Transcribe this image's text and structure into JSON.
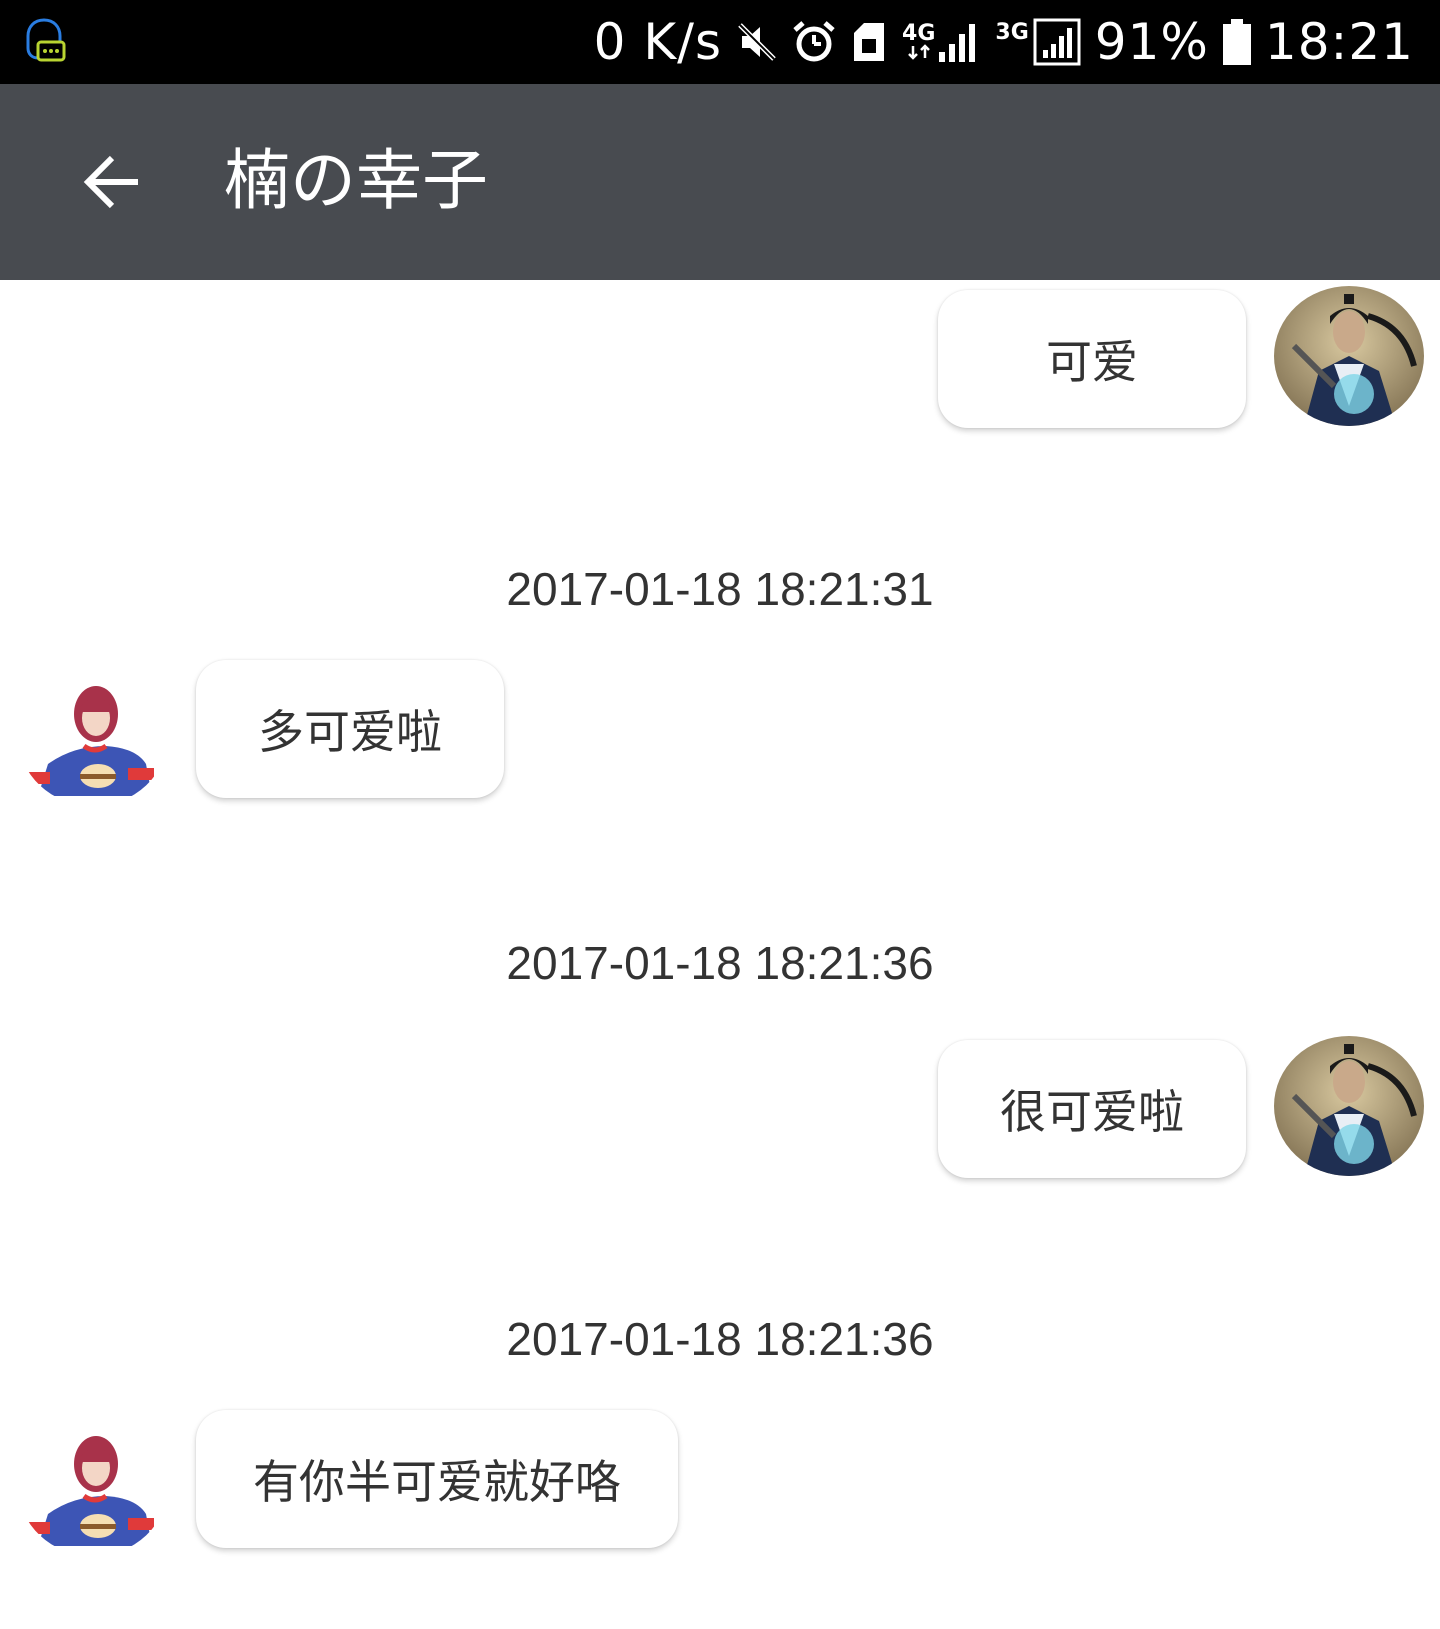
{
  "status_bar": {
    "net_speed": "0 K/s",
    "network_4g": "4G",
    "network_3g": "3G",
    "battery": "91%",
    "time": "18:21"
  },
  "header": {
    "title": "楠の幸子"
  },
  "messages": [
    {
      "sender": "me",
      "text": "可爱"
    },
    {
      "timestamp": "2017-01-18 18:21:31"
    },
    {
      "sender": "other",
      "text": "多可爱啦"
    },
    {
      "timestamp": "2017-01-18 18:21:36"
    },
    {
      "sender": "me",
      "text": "很可爱啦"
    },
    {
      "timestamp": "2017-01-18 18:21:36"
    },
    {
      "sender": "other",
      "text": "有你半可爱就好咯"
    }
  ],
  "colors": {
    "status_bg": "#000000",
    "app_bar_bg": "#484b50",
    "chat_bg": "#ffffff",
    "bubble_bg": "#ffffff",
    "text": "#333333"
  }
}
